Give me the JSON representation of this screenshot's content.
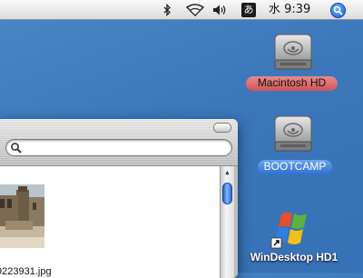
{
  "menubar": {
    "bluetooth_icon": "bluetooth-icon",
    "wifi_icon": "wifi-icon",
    "volume_icon": "volume-icon",
    "input_method": "あ",
    "clock": "水 9:39",
    "spotlight_icon": "spotlight-icon"
  },
  "desktop": {
    "icons": [
      {
        "label": "Macintosh HD",
        "icon": "hard-drive-icon",
        "label_color": "#d86060"
      },
      {
        "label": "BOOTCAMP",
        "icon": "hard-drive-icon",
        "label_color": "#3b7be0"
      },
      {
        "label": "WinDesktop HD1",
        "icon": "windows-alias-icon"
      }
    ]
  },
  "finder": {
    "search_placeholder": "",
    "file_name": "9223931.jpg"
  },
  "colors": {
    "desktop": "#3f7bbf",
    "scroll_thumb": "#3a7fe0"
  }
}
